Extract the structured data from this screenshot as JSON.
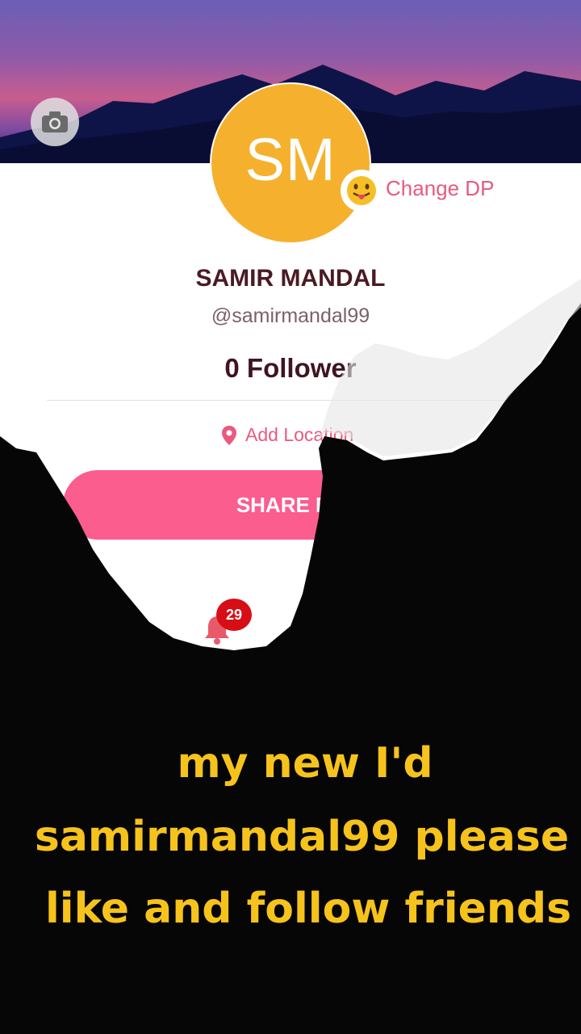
{
  "profile": {
    "initials": "SM",
    "change_dp": "Change DP",
    "name": "SAMIR MANDAL",
    "handle": "@samirmandal99",
    "followers": "0 Follower",
    "location": "Add Location",
    "share_button": "SHARE PR"
  },
  "icons": {
    "camera": "camera-icon",
    "emoji": "tongue-out-emoji-icon",
    "location": "location-pin-icon",
    "bell": "bell-icon"
  },
  "notifications": {
    "count": "29"
  },
  "caption": {
    "line1": "my new I'd",
    "line2": "samirmandal99 please",
    "line3": "like and follow friends"
  },
  "colors": {
    "accent": "#fb5d8e",
    "avatar": "#f5b12d",
    "caption": "#f6c31c",
    "badge": "#d70e16"
  }
}
